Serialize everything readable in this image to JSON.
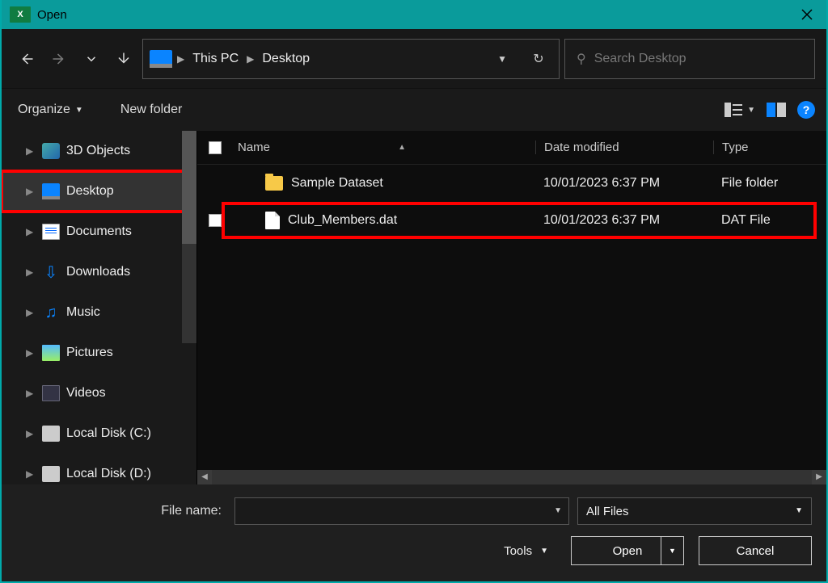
{
  "title": "Open",
  "breadcrumb": {
    "root": "This PC",
    "current": "Desktop"
  },
  "search": {
    "placeholder": "Search Desktop"
  },
  "toolbar": {
    "organize": "Organize",
    "newfolder": "New folder"
  },
  "sidebar": {
    "items": [
      {
        "label": "3D Objects"
      },
      {
        "label": "Desktop"
      },
      {
        "label": "Documents"
      },
      {
        "label": "Downloads"
      },
      {
        "label": "Music"
      },
      {
        "label": "Pictures"
      },
      {
        "label": "Videos"
      },
      {
        "label": "Local Disk (C:)"
      },
      {
        "label": "Local Disk (D:)"
      }
    ]
  },
  "columns": {
    "name": "Name",
    "date": "Date modified",
    "type": "Type"
  },
  "files": [
    {
      "name": "Sample Dataset",
      "date": "10/01/2023 6:37 PM",
      "type": "File folder"
    },
    {
      "name": "Club_Members.dat",
      "date": "10/01/2023 6:37 PM",
      "type": "DAT File"
    }
  ],
  "footer": {
    "filename_label": "File name:",
    "filter_label": "All Files",
    "tools": "Tools",
    "open": "Open",
    "cancel": "Cancel"
  }
}
